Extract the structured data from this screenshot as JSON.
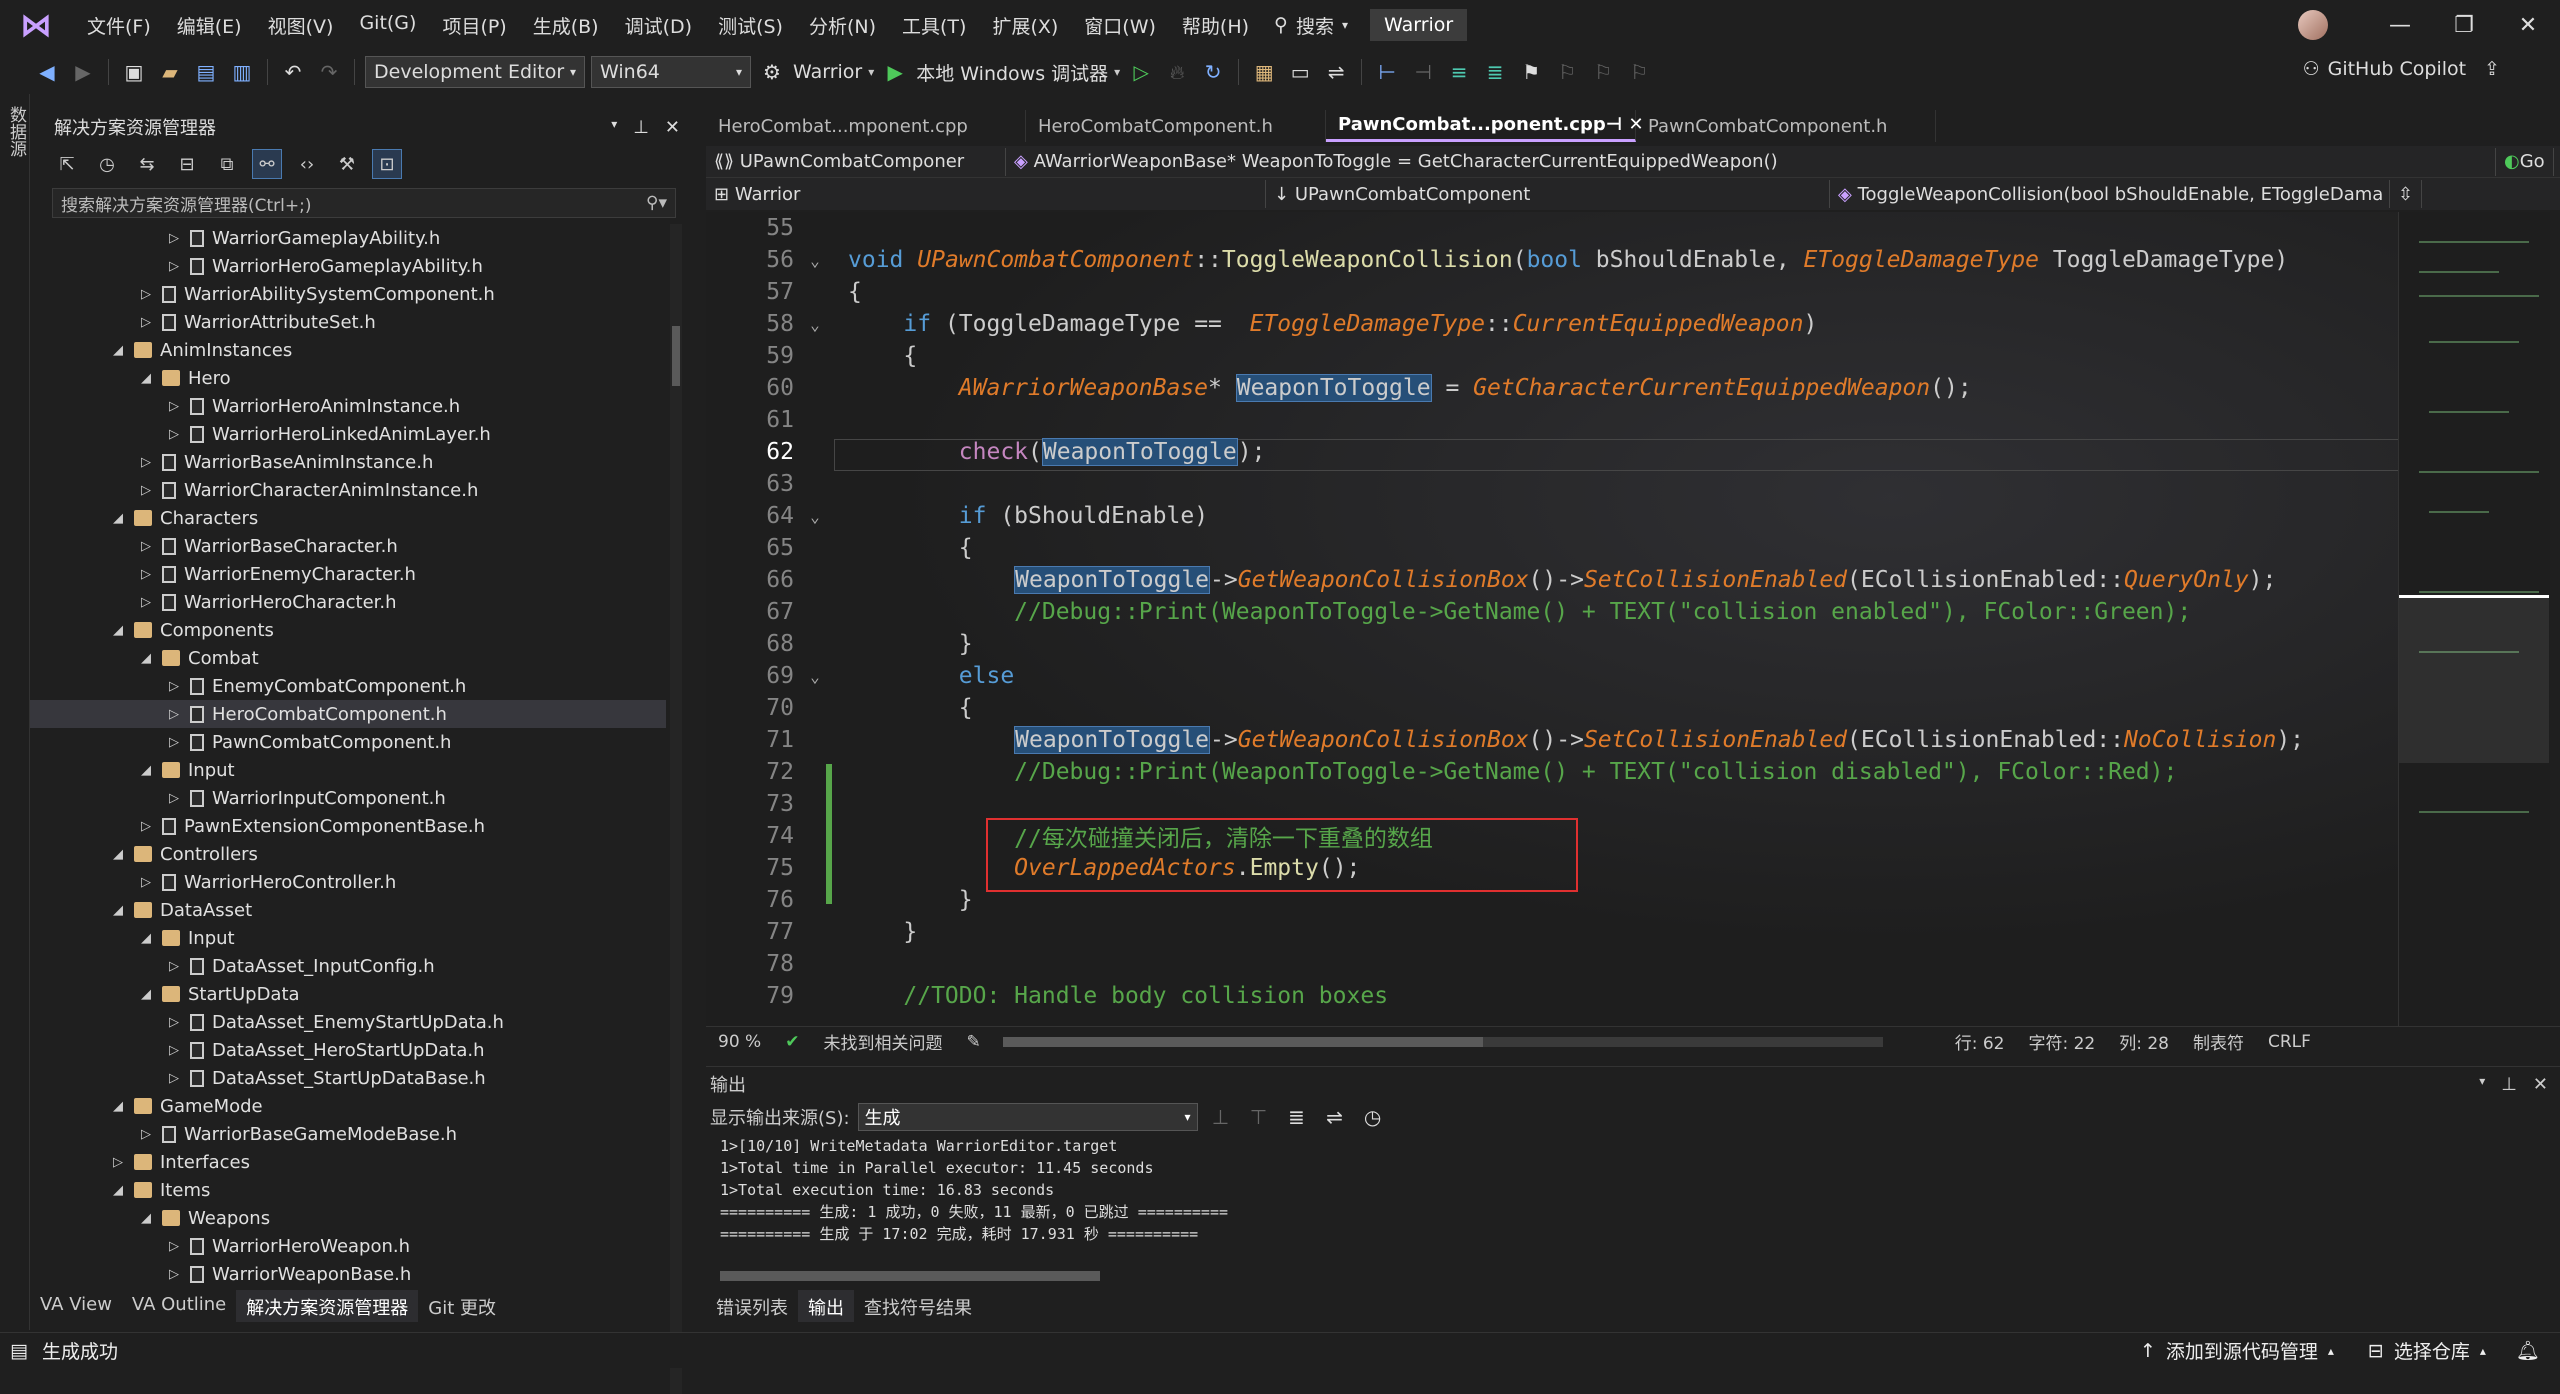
{
  "menubar": {
    "items": [
      "文件(F)",
      "编辑(E)",
      "视图(V)",
      "Git(G)",
      "项目(P)",
      "生成(B)",
      "调试(D)",
      "测试(S)",
      "分析(N)",
      "工具(T)",
      "扩展(X)",
      "窗口(W)",
      "帮助(H)"
    ],
    "search": "搜索",
    "solution_name": "Warrior"
  },
  "toolbar": {
    "config": "Development Editor",
    "platform": "Win64",
    "startup_project": "Warrior",
    "debugger": "本地 Windows 调试器",
    "copilot": "GitHub Copilot"
  },
  "vstrip": {
    "label": "数据源"
  },
  "solexp": {
    "title": "解决方案资源管理器",
    "search_placeholder": "搜索解决方案资源管理器(Ctrl+;)",
    "rows": [
      {
        "label": "WarriorGameplayAbility.h",
        "kind": "file",
        "indent": 7,
        "arrow": "▷"
      },
      {
        "label": "WarriorHeroGameplayAbility.h",
        "kind": "file",
        "indent": 7,
        "arrow": "▷"
      },
      {
        "label": "WarriorAbilitySystemComponent.h",
        "kind": "file",
        "indent": 6,
        "arrow": "▷"
      },
      {
        "label": "WarriorAttributeSet.h",
        "kind": "file",
        "indent": 6,
        "arrow": "▷"
      },
      {
        "label": "AnimInstances",
        "kind": "folder",
        "indent": 5,
        "arrow": "◢"
      },
      {
        "label": "Hero",
        "kind": "folder",
        "indent": 6,
        "arrow": "◢"
      },
      {
        "label": "WarriorHeroAnimInstance.h",
        "kind": "file",
        "indent": 7,
        "arrow": "▷"
      },
      {
        "label": "WarriorHeroLinkedAnimLayer.h",
        "kind": "file",
        "indent": 7,
        "arrow": "▷"
      },
      {
        "label": "WarriorBaseAnimInstance.h",
        "kind": "file",
        "indent": 6,
        "arrow": "▷"
      },
      {
        "label": "WarriorCharacterAnimInstance.h",
        "kind": "file",
        "indent": 6,
        "arrow": "▷"
      },
      {
        "label": "Characters",
        "kind": "folder",
        "indent": 5,
        "arrow": "◢"
      },
      {
        "label": "WarriorBaseCharacter.h",
        "kind": "file",
        "indent": 6,
        "arrow": "▷"
      },
      {
        "label": "WarriorEnemyCharacter.h",
        "kind": "file",
        "indent": 6,
        "arrow": "▷"
      },
      {
        "label": "WarriorHeroCharacter.h",
        "kind": "file",
        "indent": 6,
        "arrow": "▷"
      },
      {
        "label": "Components",
        "kind": "folder",
        "indent": 5,
        "arrow": "◢"
      },
      {
        "label": "Combat",
        "kind": "folder",
        "indent": 6,
        "arrow": "◢"
      },
      {
        "label": "EnemyCombatComponent.h",
        "kind": "file",
        "indent": 7,
        "arrow": "▷"
      },
      {
        "label": "HeroCombatComponent.h",
        "kind": "file",
        "indent": 7,
        "arrow": "▷",
        "selected": true
      },
      {
        "label": "PawnCombatComponent.h",
        "kind": "file",
        "indent": 7,
        "arrow": "▷"
      },
      {
        "label": "Input",
        "kind": "folder",
        "indent": 6,
        "arrow": "◢"
      },
      {
        "label": "WarriorInputComponent.h",
        "kind": "file",
        "indent": 7,
        "arrow": "▷"
      },
      {
        "label": "PawnExtensionComponentBase.h",
        "kind": "file",
        "indent": 6,
        "arrow": "▷"
      },
      {
        "label": "Controllers",
        "kind": "folder",
        "indent": 5,
        "arrow": "◢"
      },
      {
        "label": "WarriorHeroController.h",
        "kind": "file",
        "indent": 6,
        "arrow": "▷"
      },
      {
        "label": "DataAsset",
        "kind": "folder",
        "indent": 5,
        "arrow": "◢"
      },
      {
        "label": "Input",
        "kind": "folder",
        "indent": 6,
        "arrow": "◢"
      },
      {
        "label": "DataAsset_InputConfig.h",
        "kind": "file",
        "indent": 7,
        "arrow": "▷"
      },
      {
        "label": "StartUpData",
        "kind": "folder",
        "indent": 6,
        "arrow": "◢"
      },
      {
        "label": "DataAsset_EnemyStartUpData.h",
        "kind": "file",
        "indent": 7,
        "arrow": "▷"
      },
      {
        "label": "DataAsset_HeroStartUpData.h",
        "kind": "file",
        "indent": 7,
        "arrow": "▷"
      },
      {
        "label": "DataAsset_StartUpDataBase.h",
        "kind": "file",
        "indent": 7,
        "arrow": "▷"
      },
      {
        "label": "GameMode",
        "kind": "folder",
        "indent": 5,
        "arrow": "◢"
      },
      {
        "label": "WarriorBaseGameModeBase.h",
        "kind": "file",
        "indent": 6,
        "arrow": "▷"
      },
      {
        "label": "Interfaces",
        "kind": "folder",
        "indent": 5,
        "arrow": "▷"
      },
      {
        "label": "Items",
        "kind": "folder",
        "indent": 5,
        "arrow": "◢"
      },
      {
        "label": "Weapons",
        "kind": "folder",
        "indent": 6,
        "arrow": "◢"
      },
      {
        "label": "WarriorHeroWeapon.h",
        "kind": "file",
        "indent": 7,
        "arrow": "▷"
      },
      {
        "label": "WarriorWeaponBase.h",
        "kind": "file",
        "indent": 7,
        "arrow": "▷"
      }
    ],
    "bottom_tabs": [
      "VA View",
      "VA Outline",
      "解决方案资源管理器",
      "Git 更改"
    ]
  },
  "doctabs": [
    "HeroCombat...mponent.cpp",
    "HeroCombatComponent.h",
    "PawnCombat...ponent.cpp",
    "PawnCombatComponent.h"
  ],
  "navbar": {
    "class_scope": "UPawnCombatComponer",
    "member_scope": "AWarriorWeaponBase* WeaponToToggle = GetCharacterCurrentEquippedWeapon()",
    "project": "Warrior",
    "class": "UPawnCombatComponent",
    "function": "ToggleWeaponCollision(bool bShouldEnable, EToggleDama",
    "go": "Go"
  },
  "editor": {
    "current_line": "62"
  },
  "editor_status": {
    "zoom": "90 %",
    "issues": "未找到相关问题",
    "row": "行: 62",
    "char": "字符: 22",
    "col": "列: 28",
    "tab": "制表符",
    "eol": "CRLF"
  },
  "output": {
    "title": "输出",
    "source_label": "显示输出来源(S):",
    "source_value": "生成",
    "lines": [
      "1>[10/10] WriteMetadata WarriorEditor.target",
      "1>Total time in Parallel executor: 11.45 seconds",
      "1>Total execution time: 16.83 seconds",
      "========== 生成: 1 成功，0 失败，11 最新，0 已跳过 ==========",
      "========== 生成 于 17:02 完成，耗时 17.931 秒 =========="
    ],
    "tabs": [
      "错误列表",
      "输出",
      "查找符号结果"
    ]
  },
  "statusbar": {
    "left": "生成成功",
    "source_control": "添加到源代码管理",
    "repo": "选择仓库"
  }
}
